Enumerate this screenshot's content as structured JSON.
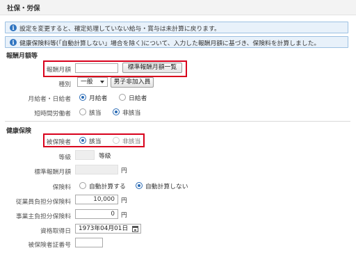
{
  "section": {
    "title": "社保・労保"
  },
  "notices": [
    {
      "icon": "info-icon",
      "text": "設定を変更すると、確定処理していない給与・賞与は未計算に戻ります。"
    },
    {
      "icon": "info-icon",
      "text": "健康保険料等(「自動計算しない」場合を除く)について、入力した報酬月額に基づき、保険料を計算しました。"
    }
  ],
  "monthly_remuneration": {
    "group_title": "報酬月額等",
    "remuneration_label": "報酬月額",
    "remuneration_value": "",
    "standard_list_button": "標準報酬月額一覧",
    "type_label": "種別",
    "type_value": "一般",
    "male_button": "男子非加入員",
    "pay_type_label": "月給者・日給者",
    "pay_type_options": [
      "月給者",
      "日給者"
    ],
    "pay_type_selected": "月給者",
    "short_time_label": "短時間労働者",
    "short_time_options": [
      "該当",
      "非該当"
    ],
    "short_time_selected": "非該当"
  },
  "health_insurance": {
    "group_title": "健康保険",
    "insured_label": "被保険者",
    "insured_options": [
      "該当",
      "非該当"
    ],
    "insured_selected": "該当",
    "grade_label": "等級",
    "grade_suffix": "等級",
    "standard_label": "標準報酬月額",
    "standard_unit": "円",
    "premium_label": "保険料",
    "premium_options": [
      "自動計算する",
      "自動計算しない"
    ],
    "premium_selected": "自動計算しない",
    "employee_label": "従業員負担分保険料",
    "employee_value": "10,000",
    "employee_unit": "円",
    "employer_label": "事業主負担分保険料",
    "employer_value": "0",
    "employer_unit": "円",
    "acquired_label": "資格取得日",
    "acquired_value": "1973年04月01日",
    "cert_label": "被保険者証番号",
    "cert_value": ""
  },
  "colors": {
    "highlight": "#d8001c",
    "accent": "#2a6bb5",
    "notice_bg": "#e8f1fa"
  }
}
